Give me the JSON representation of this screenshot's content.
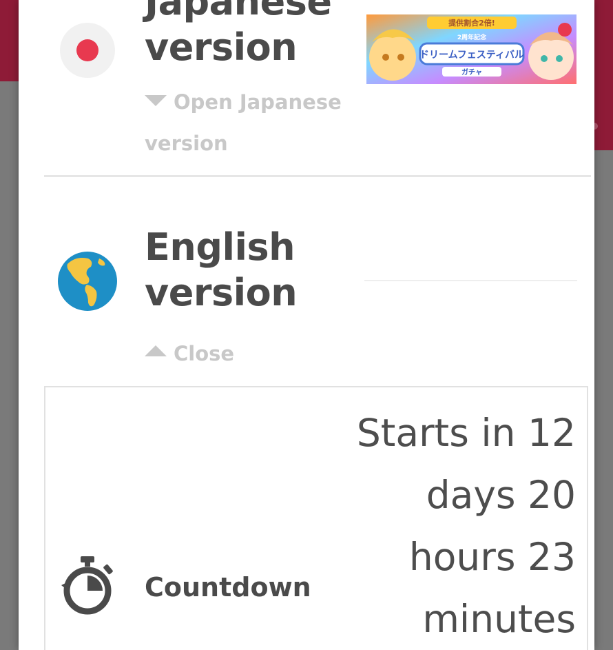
{
  "japanese": {
    "title": "Japanese version",
    "toggle_label": "Open Japanese version",
    "banner": {
      "top_text": "提供割合2倍!",
      "sub_text": "2周年記念",
      "main_text": "ドリームフェスティバル",
      "bottom_text": "ガチャ"
    }
  },
  "english": {
    "title": "English version",
    "toggle_label": "Close"
  },
  "countdown": {
    "label": "Countdown",
    "value": "Starts in 12 days 20 hours 23 minutes"
  },
  "colors": {
    "header_bg": "#8e1b37",
    "flag_red": "#e8394f",
    "globe_ocean": "#1e8fc6",
    "globe_land": "#f4c542",
    "text_dark": "#4a4a4a",
    "text_muted": "#c8c8c8"
  },
  "icons": {
    "japanese": "japan-flag-icon",
    "english": "globe-americas-icon",
    "countdown": "stopwatch-icon",
    "open_toggle": "caret-down-icon",
    "close_toggle": "caret-up-icon"
  }
}
